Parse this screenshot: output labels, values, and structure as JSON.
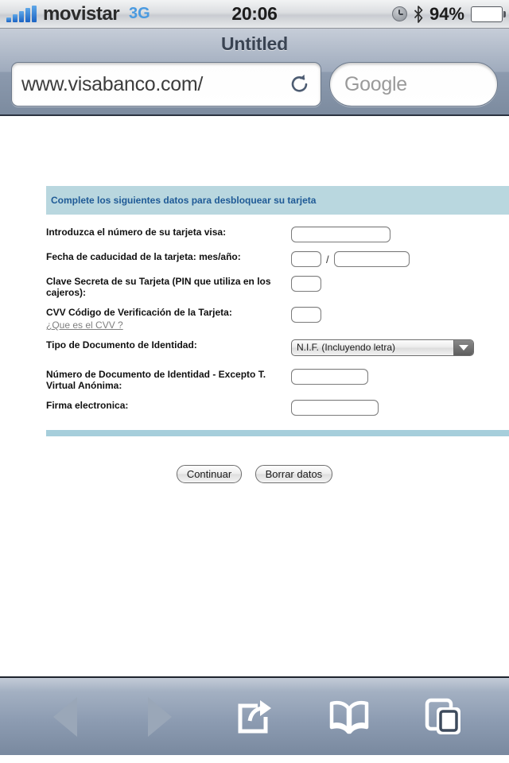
{
  "status_bar": {
    "carrier": "movistar",
    "network": "3G",
    "time": "20:06",
    "battery_percent": "94%",
    "battery_level": 94,
    "icons": [
      "signal-bars-icon",
      "clock-icon",
      "bluetooth-icon",
      "battery-icon"
    ]
  },
  "browser": {
    "page_title": "Untitled",
    "url": "www.visabanco.com/",
    "url_placeholder": "",
    "reload_icon": "reload-icon",
    "search_value": "",
    "search_placeholder": "Google"
  },
  "form": {
    "banner": "Complete los siguientes datos para desbloquear su tarjeta",
    "banner_bg": "#b9d7df",
    "banner_color": "#1f5a96",
    "rule_color": "#a6cedb",
    "rows": [
      {
        "label": "Introduzca el número de su tarjeta visa:",
        "value": ""
      },
      {
        "label": "Fecha de caducidad de la tarjeta: mes/año:",
        "value_month": "",
        "value_year": "",
        "separator": "/"
      },
      {
        "label": "Clave Secreta de su Tarjeta (PIN que utiliza en los cajeros):",
        "value": ""
      },
      {
        "label": "CVV Código de Verificación de la Tarjeta:",
        "link": "¿Que es el CVV ?",
        "value": ""
      },
      {
        "label": "Tipo de Documento de Identidad:",
        "selected": "N.I.F. (Incluyendo letra)"
      },
      {
        "label": "Número de Documento de Identidad - Excepto T. Virtual Anónima:",
        "value": ""
      },
      {
        "label": "Firma electronica:",
        "value": ""
      }
    ],
    "buttons": {
      "submit": "Continuar",
      "reset": "Borrar datos"
    }
  },
  "bottom_toolbar": {
    "items": [
      {
        "name": "back-button",
        "icon": "triangle-left-icon",
        "enabled": false
      },
      {
        "name": "forward-button",
        "icon": "triangle-right-icon",
        "enabled": false
      },
      {
        "name": "share-button",
        "icon": "share-icon",
        "enabled": true
      },
      {
        "name": "bookmarks-button",
        "icon": "book-icon",
        "enabled": true
      },
      {
        "name": "tabs-button",
        "icon": "pages-icon",
        "enabled": true
      }
    ]
  }
}
